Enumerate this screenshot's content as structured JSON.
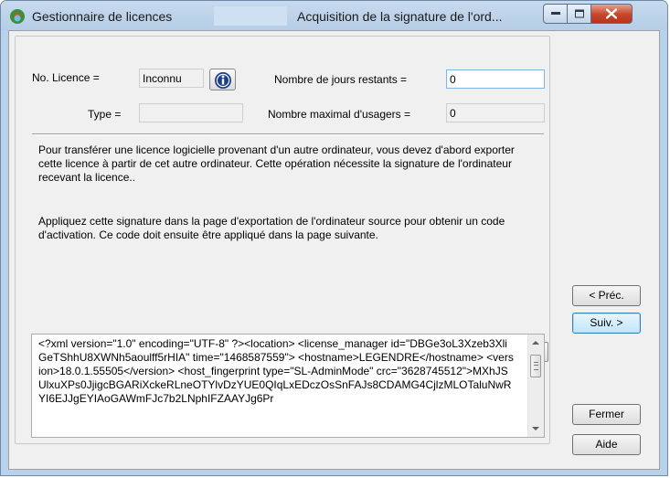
{
  "window": {
    "app_title": "Gestionnaire de licences",
    "step_title": "Acquisition de la signature de l'ord..."
  },
  "form": {
    "license_label": "No. Licence =",
    "license_value": "Inconnu",
    "type_label": "Type =",
    "type_value": "",
    "days_label": "Nombre de jours restants =",
    "days_value": "0",
    "max_users_label": "Nombre maximal d'usagers =",
    "max_users_value": "0"
  },
  "instructions": {
    "paragraph1": "Pour transférer une licence logicielle provenant d'un autre ordinateur, vous devez d'abord exporter cette licence à partir de cet autre ordinateur. Cette opération nécessite la signature de l'ordinateur recevant la licence..",
    "paragraph2": "Appliquez cette signature dans la page d'exportation de l'ordinateur source pour obtenir un code d'activation. Ce code doit ensuite être appliqué dans la page suivante."
  },
  "signature": {
    "text": "<?xml version=\"1.0\" encoding=\"UTF-8\" ?><location>  <license_manager id=\"DBGe3oL3Xzeb3XliGeTShhU8XWNh5aoulff5rHIA\" time=\"1468587559\">  <hostname>LEGENDRE</hostname>    <version>18.0.1.55505</version>  <host_fingerprint type=\"SL-AdminMode\" crc=\"3628745512\">MXhJSUlxuXPs0JjigcBGARiXckeRLneOTYlvDzYUE0QIqLxEDczOsSnFAJs8CDAMG4CjlzMLOTaluNwRYI6EJJgEYIAoGAWmFJc7b2LNphIFZAAYJg6Pr"
  },
  "buttons": {
    "prev": "< Préc.",
    "next": "Suiv. >",
    "close": "Fermer",
    "help": "Aide"
  },
  "icons": {
    "app": "license-manager-icon",
    "info": "info-icon",
    "copy": "copy-icon",
    "save": "save-icon"
  }
}
